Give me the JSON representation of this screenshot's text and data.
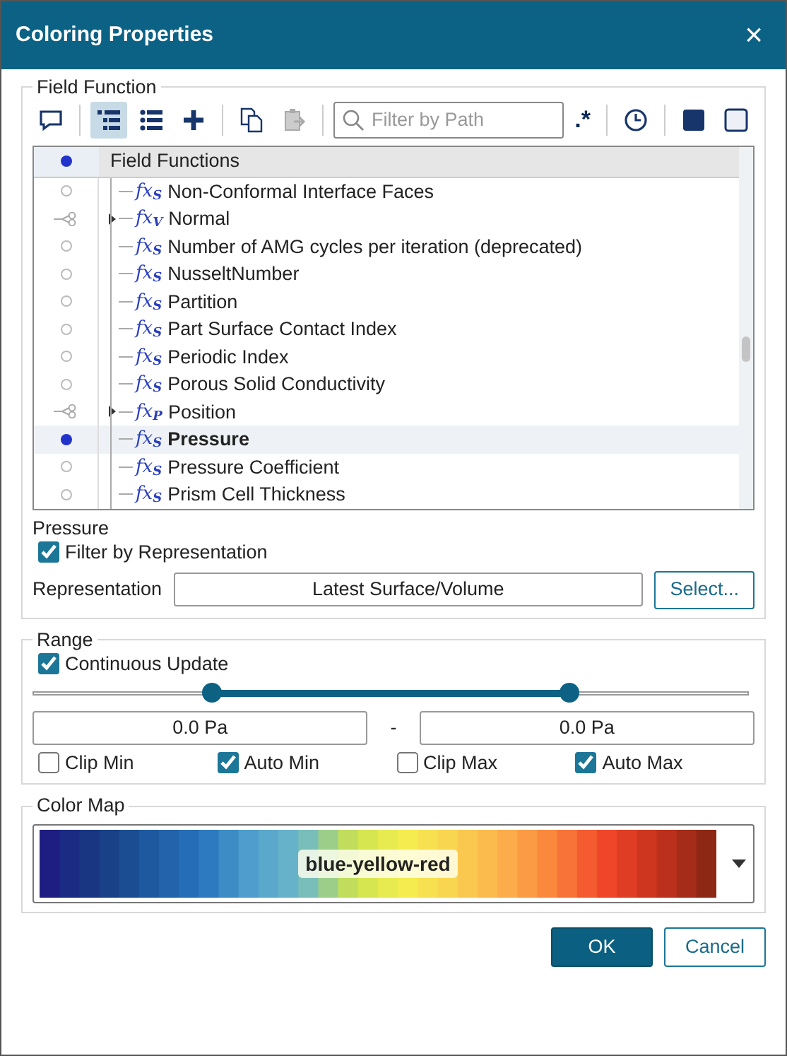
{
  "window": {
    "title": "Coloring Properties",
    "close": "×"
  },
  "field_function": {
    "title": "Field Function",
    "toolbar": [
      {
        "kind": "comment",
        "selected": false,
        "disabled": false
      },
      {
        "kind": "separator"
      },
      {
        "kind": "tree",
        "selected": true,
        "disabled": false
      },
      {
        "kind": "list",
        "selected": false,
        "disabled": false
      },
      {
        "kind": "plus",
        "selected": false,
        "disabled": false
      },
      {
        "kind": "separator"
      },
      {
        "kind": "copy",
        "selected": false,
        "disabled": false
      },
      {
        "kind": "paste",
        "selected": false,
        "disabled": true
      },
      {
        "kind": "separator"
      }
    ],
    "filter": {
      "placeholder": "Filter by Path"
    },
    "regex": ".*",
    "toolbar_right": [
      {
        "kind": "separator"
      },
      {
        "kind": "clock",
        "selected": false,
        "disabled": false
      },
      {
        "kind": "separator"
      },
      {
        "kind": "filled-square",
        "selected": false,
        "disabled": false
      },
      {
        "kind": "empty-square",
        "selected": false,
        "disabled": false
      }
    ],
    "tree": {
      "header": {
        "label": "Field Functions",
        "selected": true
      },
      "items": [
        {
          "symbol": "fx$_{S}$",
          "label": "Non-Conformal Interface Faces",
          "kind": "radio",
          "expandable": false,
          "selected": false
        },
        {
          "symbol": "fx$_{V}$",
          "label": "Normal",
          "kind": "node",
          "expandable": true,
          "selected": false
        },
        {
          "symbol": "fx$_{S}$",
          "label": "Number of AMG cycles per iteration (deprecated)",
          "kind": "radio",
          "expandable": false,
          "selected": false
        },
        {
          "symbol": "fx$_{S}$",
          "label": "NusseltNumber",
          "kind": "radio",
          "expandable": false,
          "selected": false
        },
        {
          "symbol": "fx$_{S}$",
          "label": "Partition",
          "kind": "radio",
          "expandable": false,
          "selected": false
        },
        {
          "symbol": "fx$_{S}$",
          "label": "Part Surface Contact Index",
          "kind": "radio",
          "expandable": false,
          "selected": false
        },
        {
          "symbol": "fx$_{S}$",
          "label": "Periodic Index",
          "kind": "radio",
          "expandable": false,
          "selected": false
        },
        {
          "symbol": "fx$_{S}$",
          "label": "Porous Solid Conductivity",
          "kind": "radio",
          "expandable": false,
          "selected": false
        },
        {
          "symbol": "fx$_{P}$",
          "label": "Position",
          "kind": "node",
          "expandable": true,
          "selected": false
        },
        {
          "symbol": "fx$_{S}$",
          "label": "Pressure",
          "kind": "radio",
          "expandable": false,
          "selected": true
        },
        {
          "symbol": "fx$_{S}$",
          "label": "Pressure Coefficient",
          "kind": "radio",
          "expandable": false,
          "selected": false
        },
        {
          "symbol": "fx$_{S}$",
          "label": "Prism Cell Thickness",
          "kind": "radio",
          "expandable": false,
          "selected": false
        }
      ]
    },
    "selection_label": "Pressure",
    "filter_by_representation": {
      "label": "Filter by Representation",
      "checked": true
    },
    "representation": {
      "label": "Representation",
      "value": "Latest Surface/Volume",
      "button": "Select..."
    }
  },
  "range": {
    "title": "Range",
    "continuous_update": {
      "label": "Continuous Update",
      "checked": true
    },
    "slider": {
      "low": {
        "level": 0.25
      },
      "high": {
        "level": 0.75
      }
    },
    "min": "0.0 Pa",
    "separator": "-",
    "max": "0.0 Pa",
    "options": [
      {
        "label": "Clip Min",
        "checked": false
      },
      {
        "label": "Auto Min",
        "checked": true
      },
      {
        "label": "Clip Max",
        "checked": false
      },
      {
        "label": "Auto Max",
        "checked": true
      }
    ]
  },
  "color_map": {
    "title": "Color Map",
    "value": "blue-yellow-red"
  },
  "buttons": [
    {
      "label": "OK",
      "kind": "primary"
    },
    {
      "label": "Cancel",
      "kind": "secondary"
    }
  ]
}
